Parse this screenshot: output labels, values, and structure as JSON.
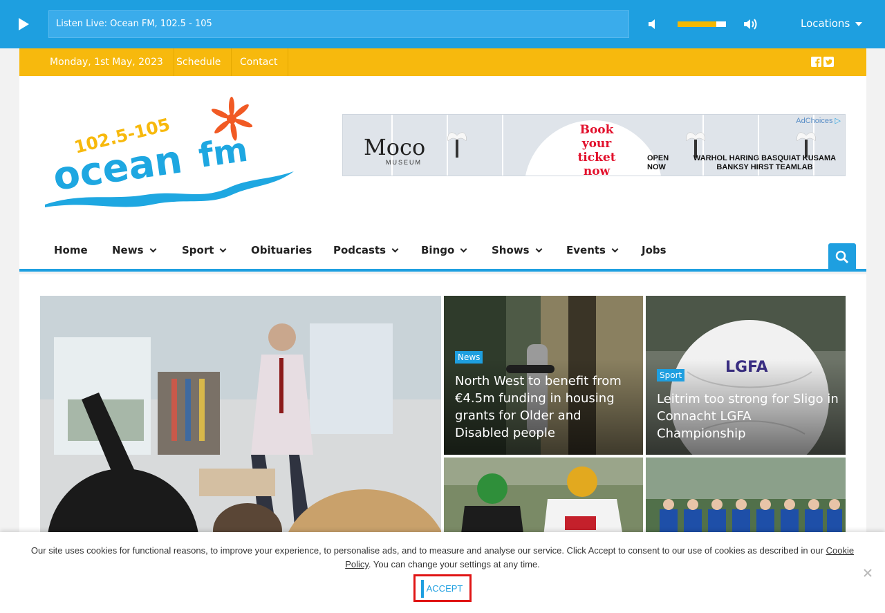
{
  "player": {
    "now_playing": "Listen Live: Ocean FM, 102.5 - 105",
    "volume_fraction": 0.8,
    "locations_label": "Locations"
  },
  "topbar": {
    "date": "Monday, 1st May, 2023",
    "schedule": "Schedule",
    "contact": "Contact"
  },
  "header": {
    "ad": {
      "choices": "AdChoices",
      "brand": "Moco",
      "brand_sub": "MUSEUM",
      "cta_line1": "Book",
      "cta_line2": "your ticket",
      "cta_line3": "now",
      "open_line1": "OPEN",
      "open_line2": "NOW",
      "artists_line1": "WARHOL HARING BASQUIAT KUSAMA",
      "artists_line2": "BANKSY HIRST TEAMLAB"
    }
  },
  "nav": {
    "items": [
      {
        "label": "Home"
      },
      {
        "label": "News"
      },
      {
        "label": "Sport"
      },
      {
        "label": "Obituaries"
      },
      {
        "label": "Podcasts"
      },
      {
        "label": "Bingo"
      },
      {
        "label": "Shows"
      },
      {
        "label": "Events"
      },
      {
        "label": "Jobs"
      }
    ]
  },
  "articles": [
    {
      "category": "News",
      "headline": "North West to benefit from €4.5m funding in housing grants for Older and Disabled people"
    },
    {
      "category": "Sport",
      "headline": "Leitrim too strong for Sligo in Connacht LGFA Championship"
    }
  ],
  "cookie": {
    "text_before": "Our site uses cookies for functional reasons, to improve your experience, to personalise ads, and to measure and analyse our service. Click Accept to consent to our use of cookies as described in our ",
    "link_part1": "Cookie",
    "link_part2": "Policy",
    "text_after": ". You can change your settings at any time.",
    "accept": "ACCEPT"
  },
  "colors": {
    "brand_blue": "#1e9fe0",
    "brand_yellow": "#f7b90d",
    "logo_orange": "#f15a24"
  }
}
